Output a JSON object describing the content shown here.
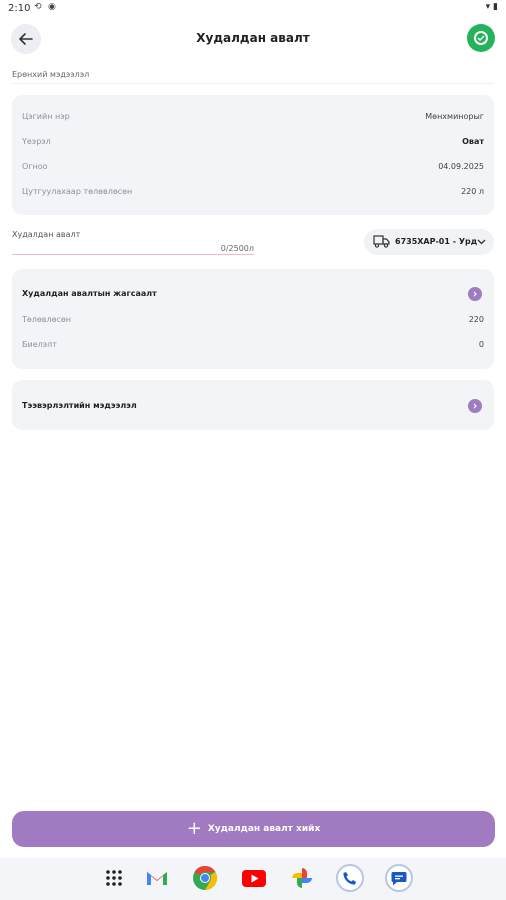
{
  "status_bar": {
    "time": "2:10"
  },
  "header": {
    "title": "Худалдан авалт"
  },
  "general": {
    "section_label": "Ерөнхий мэдээлэл",
    "rows": [
      {
        "label": "Цэгийн нэр",
        "value": "Мөнхминорыг",
        "bold": false
      },
      {
        "label": "Үеэрэл",
        "value": "Оват",
        "bold": true
      },
      {
        "label": "Огноо",
        "value": "04.09.2025",
        "bold": false
      },
      {
        "label": "Цутгуулахаар төлөвлөсөн",
        "value": "220 л",
        "bold": false
      }
    ]
  },
  "purchase_input": {
    "label": "Худалдан авалт",
    "counter": "0/2500л"
  },
  "vehicle": {
    "label": "6735ХАР-01 - Урд"
  },
  "summary": {
    "title": "Худалдан авалтын жагсаалт",
    "rows": [
      {
        "label": "Төлөвлөсөн",
        "value": "220"
      },
      {
        "label": "Биелэлт",
        "value": "0"
      }
    ]
  },
  "technical": {
    "title": "Тээвэрлэлтийн мэдээлэл"
  },
  "add_button": {
    "label": "Худалдан авалт хийх"
  },
  "colors": {
    "accent": "#a17bc1",
    "success": "#24b35a",
    "card": "#f2f4f7"
  },
  "icons": [
    "back-arrow-icon",
    "check-circle-icon",
    "truck-icon",
    "chevron-down-icon",
    "chevron-right-icon",
    "plus-icon"
  ]
}
